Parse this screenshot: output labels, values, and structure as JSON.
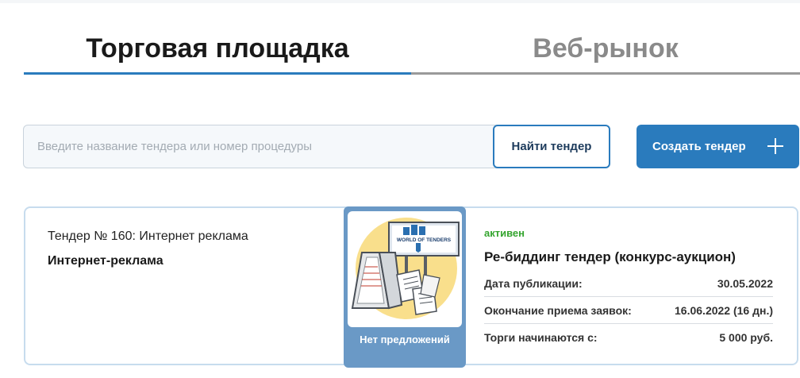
{
  "tabs": [
    {
      "label": "Торговая площадка",
      "active": true
    },
    {
      "label": "Веб-рынок",
      "active": false
    }
  ],
  "search": {
    "placeholder": "Введите название тендера или номер процедуры",
    "value": "",
    "find_button": "Найти тендер",
    "create_button": "Создать тендер",
    "create_icon": "plus-icon"
  },
  "tender": {
    "title": "Тендер № 160: Интернет реклама",
    "category": "Интернет-реклама",
    "offers_label": "Нет предложений",
    "billboard_text": "WORLD OF TENDERS",
    "status": "активен",
    "procedure_type": "Ре-биддинг тендер (конкурс-аукцион)",
    "rows": [
      {
        "label": "Дата публикации:",
        "value": "30.05.2022"
      },
      {
        "label": "Окончание приема заявок:",
        "value": "16.06.2022 (16 дн.)"
      },
      {
        "label": "Торги начинаются с:",
        "value": "5 000 руб."
      }
    ]
  },
  "colors": {
    "accent": "#2a7bbd",
    "status_active": "#35a52f",
    "offer_panel": "#6a99c6"
  }
}
